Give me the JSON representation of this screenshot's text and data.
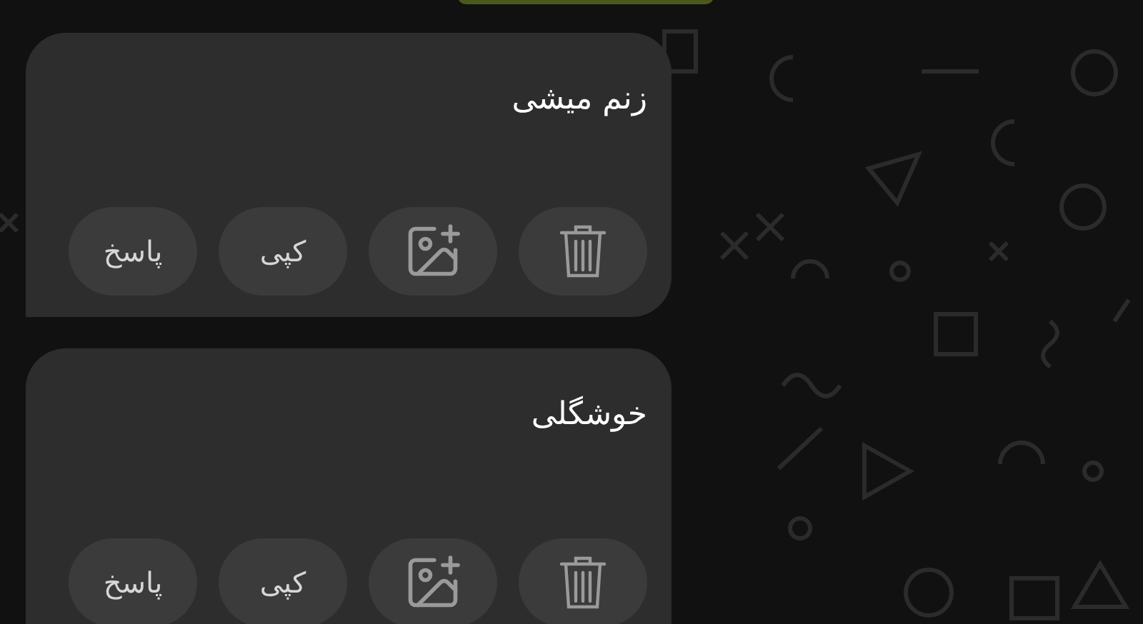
{
  "messages": [
    {
      "text": "زنم میشی",
      "actions": [
        {
          "kind": "delete"
        },
        {
          "kind": "add-image"
        },
        {
          "kind": "text",
          "label": "کپی"
        },
        {
          "kind": "text",
          "label": "پاسخ"
        }
      ]
    },
    {
      "text": "خوشگلی",
      "actions": [
        {
          "kind": "delete"
        },
        {
          "kind": "add-image"
        },
        {
          "kind": "text",
          "label": "کپی"
        },
        {
          "kind": "text",
          "label": "پاسخ"
        }
      ]
    }
  ]
}
